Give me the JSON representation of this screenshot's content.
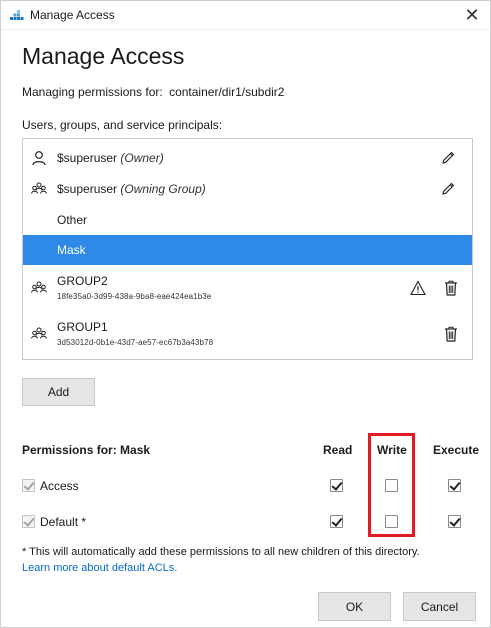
{
  "window": {
    "title": "Manage Access",
    "close_glyph": "✕"
  },
  "heading": "Manage Access",
  "managing": {
    "label": "Managing permissions for:",
    "path": "container/dir1/subdir2"
  },
  "principals": {
    "label": "Users, groups, and service principals:",
    "items": [
      {
        "name": "$superuser",
        "qualifier": "(Owner)",
        "icon": "user-icon",
        "action": "pencil-icon"
      },
      {
        "name": "$superuser",
        "qualifier": "(Owning Group)",
        "icon": "group-icon",
        "action": "pencil-icon"
      },
      {
        "name": "Other"
      },
      {
        "name": "Mask",
        "selected": true
      },
      {
        "name": "GROUP2",
        "id": "18fe35a0-3d99-438a-9ba8-eae424ea1b3e",
        "icon": "group-icon",
        "warning": true,
        "action": "trash-icon"
      },
      {
        "name": "GROUP1",
        "id": "3d53012d-0b1e-43d7-ae57-ec67b3a43b78",
        "icon": "group-icon",
        "action": "trash-icon"
      }
    ]
  },
  "add_button": "Add",
  "permissions": {
    "header": "Permissions for: Mask",
    "columns": [
      "Read",
      "Write",
      "Execute"
    ],
    "rows": [
      {
        "label": "Access",
        "enabled": true,
        "read": true,
        "write": false,
        "execute": true
      },
      {
        "label": "Default *",
        "enabled": true,
        "read": true,
        "write": false,
        "execute": true
      }
    ]
  },
  "footnote": "* This will automatically add these permissions to all new children of this directory.",
  "learn_more": "Learn more about default ACLs.",
  "buttons": {
    "ok": "OK",
    "cancel": "Cancel"
  },
  "colors": {
    "selection": "#2e8ae6",
    "link": "#0b6acb",
    "highlight_box": "#e31c23"
  }
}
